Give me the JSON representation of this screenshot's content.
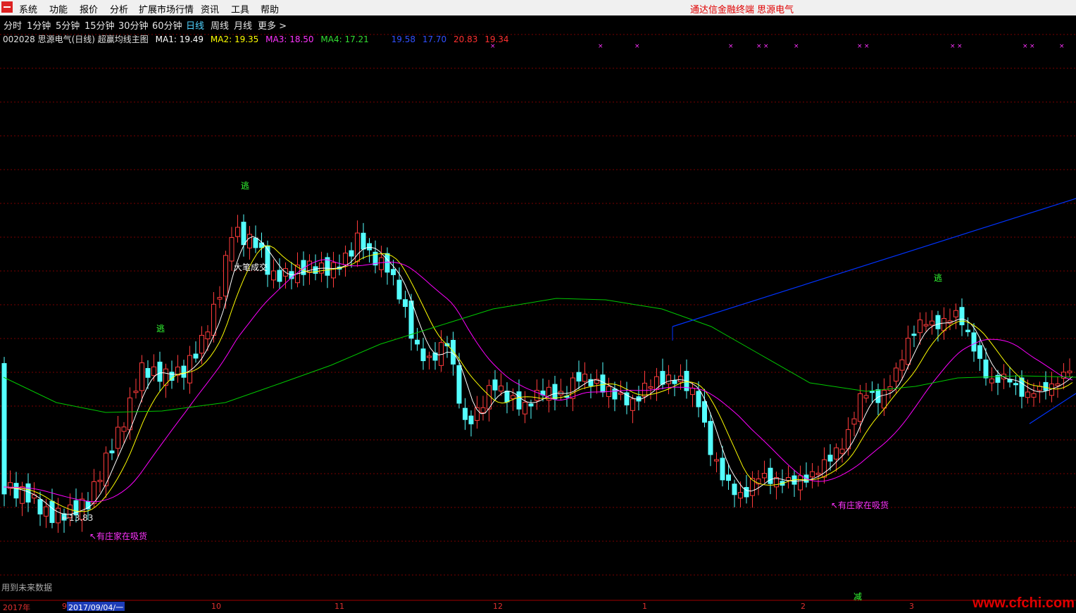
{
  "menubar": {
    "items": [
      "系统",
      "功能",
      "报价",
      "分析",
      "扩展市场行情",
      "资讯",
      "工具",
      "帮助"
    ],
    "title_info": "通达信金融终端   思源电气"
  },
  "periods": {
    "items": [
      "分时",
      "1分钟",
      "5分钟",
      "15分钟",
      "30分钟",
      "60分钟",
      "日线",
      "周线",
      "月线",
      "更多 >"
    ],
    "active": "日线"
  },
  "legend": {
    "code_name": "002028 思源电气(日线) 超赢均线主图",
    "ma1": "MA1: 19.49",
    "ma2": "MA2: 19.35",
    "ma3": "MA3: 18.50",
    "ma4": "MA4: 17.21",
    "v1": "19.58",
    "v2": "17.70",
    "v3": "20.83",
    "v4": "19.34"
  },
  "colors": {
    "up": "#ff3b3b",
    "down": "#54ffff",
    "ma1": "#ffffff",
    "ma2": "#ffff00",
    "ma3": "#ff00ff",
    "ma4": "#00c800",
    "trend": "#0033ff",
    "grid": "#7a0000"
  },
  "annotations": {
    "escape1": "逃",
    "escape2": "逃",
    "escape3": "逃",
    "big_volume": "大笔成交",
    "low_price": "←13.83",
    "absorb1": "↖有庄家在吸货",
    "absorb2": "↖有庄家在吸货",
    "reduce": "减"
  },
  "footnote": "用到未来数据",
  "time_axis": {
    "year": "2017年",
    "labels": [
      "9",
      "10",
      "11",
      "12",
      "1",
      "2",
      "3"
    ],
    "cursor_date": "2017/09/04/一"
  },
  "watermark": "www.cfchi.com",
  "chart_data": {
    "type": "candlestick",
    "series": [
      {
        "name": "MA1",
        "value": 19.49
      },
      {
        "name": "MA2",
        "value": 19.35
      },
      {
        "name": "MA3",
        "value": 18.5
      },
      {
        "name": "MA4",
        "value": 17.21
      }
    ],
    "low_label": 13.83
  }
}
